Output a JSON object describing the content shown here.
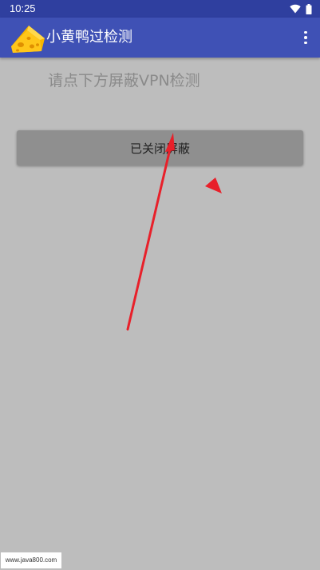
{
  "status_bar": {
    "time": "10:25",
    "icons": [
      "wifi-icon",
      "battery-icon"
    ]
  },
  "app_bar": {
    "title": "小黄鸭过检测",
    "logo_icon": "cheese-icon",
    "menu_icon": "more-vert-icon",
    "color": "#3f51b5"
  },
  "main": {
    "hint_text": "请点下方屏蔽VPN检测",
    "shield_button_label": "已关闭屏蔽"
  },
  "annotation": {
    "arrow_color": "#e8202a"
  },
  "watermark": {
    "text": "www.java800.com"
  }
}
